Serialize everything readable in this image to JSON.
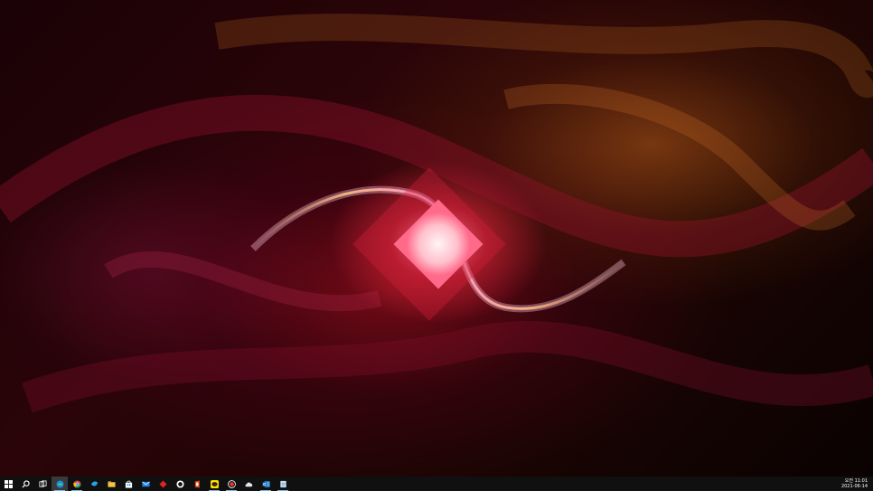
{
  "taskbar": {
    "pinned": [
      {
        "icon": "windows-start-icon"
      },
      {
        "icon": "search-icon"
      },
      {
        "icon": "task-view-icon"
      },
      {
        "icon": "edge-browser-icon"
      },
      {
        "icon": "chrome-browser-icon"
      },
      {
        "icon": "bird-app-icon"
      },
      {
        "icon": "file-explorer-icon"
      },
      {
        "icon": "store-icon"
      },
      {
        "icon": "mail-icon"
      },
      {
        "icon": "red-diamond-app-icon"
      },
      {
        "icon": "github-icon"
      },
      {
        "icon": "office-icon"
      },
      {
        "icon": "kakaotalk-icon"
      },
      {
        "icon": "record-icon"
      },
      {
        "icon": "cloud-app-icon"
      },
      {
        "icon": "outlook-icon"
      },
      {
        "icon": "notepad-app-icon"
      }
    ],
    "clock": {
      "time": "오전 11:01",
      "date": "2021-06-14"
    }
  },
  "colors": {
    "taskbar_bg": "#101010",
    "accent": "#76b9ed",
    "wallpaper_red": "#c8102e",
    "wallpaper_orange": "#c8661a"
  }
}
